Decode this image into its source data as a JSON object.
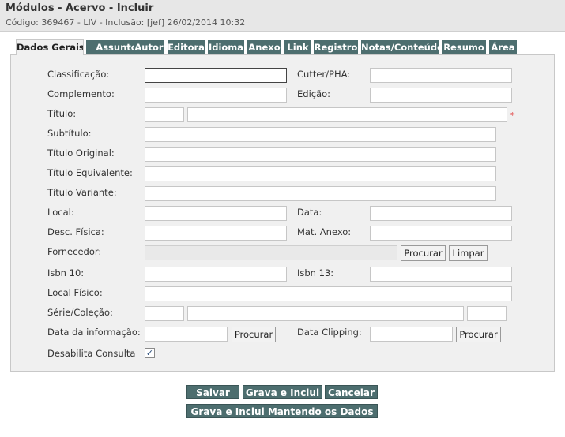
{
  "window": {
    "title": "Módulos - Acervo - Incluir",
    "subtitle": "Código: 369467 - LIV - Inclusão: [jef] 26/02/2014 10:32"
  },
  "tabs": [
    {
      "label": "Dados Gerais",
      "active": true
    },
    {
      "label": "Assunto"
    },
    {
      "label": "Autor"
    },
    {
      "label": "Editora"
    },
    {
      "label": "Idioma"
    },
    {
      "label": "Anexo"
    },
    {
      "label": "Link"
    },
    {
      "label": "Registro"
    },
    {
      "label": "Notas/Conteúdo"
    },
    {
      "label": "Resumo"
    },
    {
      "label": "Área"
    }
  ],
  "form": {
    "classificacao": "Classificação:",
    "cutter": "Cutter/PHA:",
    "complemento": "Complemento:",
    "edicao": "Edição:",
    "titulo": "Título:",
    "required_mark": "*",
    "subtitulo": "Subtítulo:",
    "titulo_original": "Título Original:",
    "titulo_equivalente": "Título Equivalente:",
    "titulo_variante": "Título Variante:",
    "local": "Local:",
    "data": "Data:",
    "desc_fisica": "Desc. Física:",
    "mat_anexo": "Mat. Anexo:",
    "fornecedor": "Fornecedor:",
    "procurar": "Procurar",
    "limpar": "Limpar",
    "isbn10": "Isbn 10:",
    "isbn13": "Isbn 13:",
    "local_fisico": "Local Físico:",
    "serie_colecao": "Série/Coleção:",
    "data_informacao": "Data da informação:",
    "data_clipping": "Data Clipping:",
    "desabilita_consulta": "Desabilita Consulta",
    "desabilita_checked": true,
    "check_mark": "✓"
  },
  "actions": {
    "salvar": "Salvar",
    "grava_inclui": "Grava e Inclui",
    "cancelar": "Cancelar",
    "grava_inclui_mantendo": "Grava e Inclui Mantendo os Dados"
  }
}
